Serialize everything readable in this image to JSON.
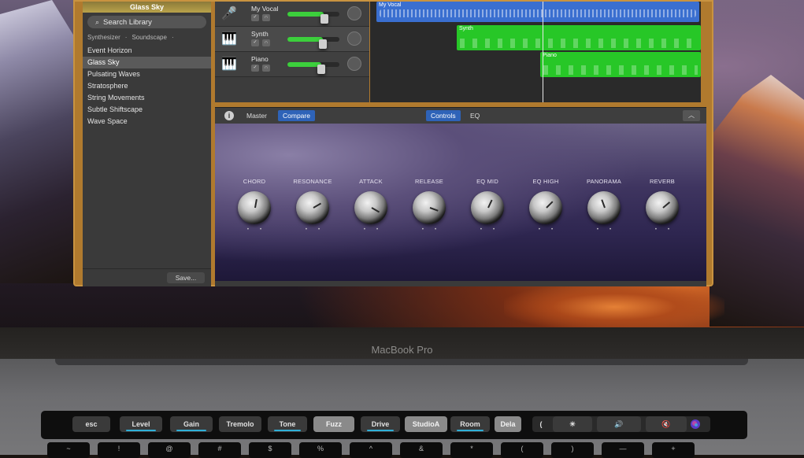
{
  "library": {
    "patch_name": "Glass Sky",
    "search_placeholder": "Search Library",
    "crumbs": [
      "Synthesizer",
      "Soundscape"
    ],
    "items": [
      "Event Horizon",
      "Glass Sky",
      "Pulsating Waves",
      "Stratosphere",
      "String Movements",
      "Subtle Shiftscape",
      "Wave Space"
    ],
    "selected_item": "Glass Sky",
    "save_label": "Save..."
  },
  "tracks": [
    {
      "name": "My Vocal",
      "icon": "microphone-icon",
      "volume": 0.7
    },
    {
      "name": "Synth",
      "icon": "synth-icon",
      "volume": 0.68
    },
    {
      "name": "Piano",
      "icon": "piano-icon",
      "volume": 0.65
    }
  ],
  "regions": {
    "vocal": "My Vocal",
    "synth": "Synth",
    "piano": "Piano"
  },
  "smart_controls": {
    "master_label": "Master",
    "compare_label": "Compare",
    "controls_tab": "Controls",
    "eq_tab": "EQ",
    "info_label": "i",
    "collapse_label": "︿"
  },
  "knobs": [
    "CHORD",
    "RESONANCE",
    "ATTACK",
    "RELEASE",
    "EQ MID",
    "EQ HIGH",
    "PANORAMA",
    "REVERB"
  ],
  "laptop": {
    "brand": "MacBook Pro"
  },
  "touchbar": {
    "esc": "esc",
    "keys": [
      "Level",
      "Gain",
      "Tremolo",
      "Tone",
      "Fuzz",
      "Drive",
      "StudioA",
      "Room",
      "Dela"
    ],
    "control_strip": [
      "(",
      "☀",
      "🔊",
      "🔇",
      "siri"
    ]
  },
  "keyboard_row": [
    "~",
    "!",
    "@",
    "#",
    "$",
    "%",
    "^",
    "&",
    "*",
    "(",
    ")",
    "—",
    "+"
  ],
  "colors": {
    "accent_blue": "#2e63b8",
    "midi_green": "#27c727",
    "window_frame": "#b07a2e"
  }
}
